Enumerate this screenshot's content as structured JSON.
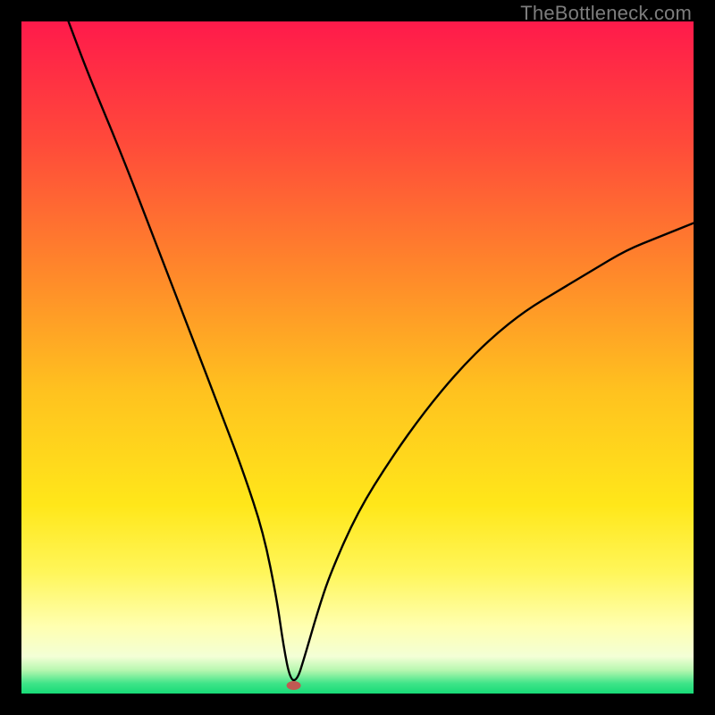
{
  "watermark": "TheBottleneck.com",
  "chart_data": {
    "type": "line",
    "title": "",
    "xlabel": "",
    "ylabel": "",
    "xlim": [
      0,
      100
    ],
    "ylim": [
      0,
      100
    ],
    "grid": false,
    "legend": false,
    "background_gradient": {
      "stops": [
        {
          "offset": 0.0,
          "color": "#ff1a4b"
        },
        {
          "offset": 0.18,
          "color": "#ff4a3a"
        },
        {
          "offset": 0.38,
          "color": "#ff8a2a"
        },
        {
          "offset": 0.55,
          "color": "#ffc21f"
        },
        {
          "offset": 0.72,
          "color": "#ffe71a"
        },
        {
          "offset": 0.82,
          "color": "#fff65a"
        },
        {
          "offset": 0.9,
          "color": "#ffffb0"
        },
        {
          "offset": 0.945,
          "color": "#f3ffd6"
        },
        {
          "offset": 0.965,
          "color": "#b8f7b0"
        },
        {
          "offset": 0.985,
          "color": "#3ee488"
        },
        {
          "offset": 1.0,
          "color": "#18db77"
        }
      ]
    },
    "curve": {
      "description": "V-shaped bottleneck curve: steep near-linear descent from top-left, minimum near x≈40, then concave-increasing right branch reaching ~70 at right edge.",
      "x": [
        7,
        10,
        15,
        20,
        25,
        30,
        33,
        36,
        38,
        39,
        40,
        41,
        42,
        44,
        46,
        50,
        55,
        60,
        65,
        70,
        75,
        80,
        85,
        90,
        95,
        100
      ],
      "y": [
        100,
        92,
        80,
        67,
        54,
        41,
        33,
        24,
        14,
        7,
        2,
        2,
        5,
        12,
        18,
        27,
        35,
        42,
        48,
        53,
        57,
        60,
        63,
        66,
        68,
        70
      ]
    },
    "marker": {
      "x": 40.5,
      "y": 1.2,
      "color": "#c05a52",
      "rx": 8,
      "ry": 5
    }
  }
}
